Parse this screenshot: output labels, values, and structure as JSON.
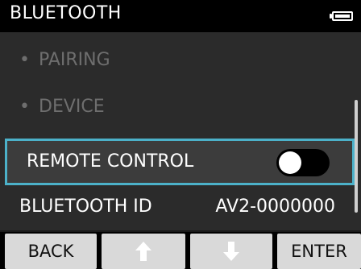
{
  "header": {
    "title": "BLUETOOTH",
    "battery_icon": "battery-icon"
  },
  "menu": {
    "items": [
      {
        "label": "PAIRING",
        "bullet": "•",
        "state": "disabled"
      },
      {
        "label": "DEVICE",
        "bullet": "•",
        "state": "disabled"
      },
      {
        "label": "REMOTE CONTROL",
        "state": "selected",
        "toggle": "off"
      },
      {
        "label": "BLUETOOTH ID",
        "value": "AV2-0000000"
      }
    ]
  },
  "footer": {
    "back_label": "BACK",
    "up_icon": "arrow-up-icon",
    "down_icon": "arrow-down-icon",
    "enter_label": "ENTER"
  },
  "colors": {
    "highlight_border": "#4cb1c9",
    "background": "#2b2b2b",
    "disabled_text": "#6e6e6e"
  }
}
